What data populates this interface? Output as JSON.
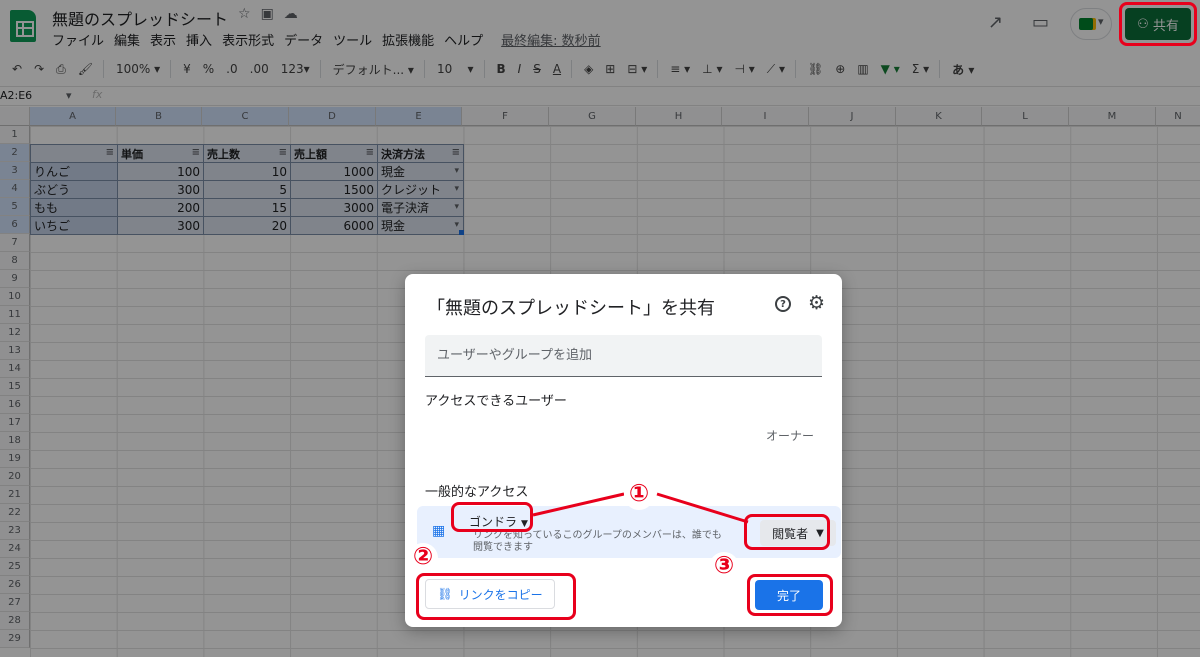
{
  "header": {
    "title": "無題のスプレッドシート",
    "menu": [
      "ファイル",
      "編集",
      "表示",
      "挿入",
      "表示形式",
      "データ",
      "ツール",
      "拡張機能",
      "ヘルプ"
    ],
    "last_edit": "最終編集: 数秒前",
    "share_label": "共有"
  },
  "toolbar": {
    "zoom": "100%",
    "currency": "¥",
    "percent": "%",
    "dec_less": ".0",
    "dec_more": ".00",
    "format": "123▾",
    "font": "デフォルト...",
    "font_size": "10",
    "input_tool": "あ"
  },
  "formula_bar": {
    "name_box": "A2:E6",
    "fx": "fx"
  },
  "grid": {
    "columns": [
      "A",
      "B",
      "C",
      "D",
      "E",
      "F",
      "G",
      "H",
      "I",
      "J",
      "K",
      "L",
      "M",
      "N"
    ],
    "rows": [
      "1",
      "2",
      "3",
      "4",
      "5",
      "6",
      "7",
      "8",
      "9",
      "10",
      "11",
      "12",
      "13",
      "14",
      "15",
      "16",
      "17",
      "18",
      "19",
      "20",
      "21",
      "22",
      "23",
      "24",
      "25",
      "26",
      "27",
      "28",
      "29"
    ],
    "table_headers": [
      "",
      "単価",
      "売上数",
      "売上額",
      "決済方法"
    ],
    "table_rows": [
      [
        "りんご",
        "100",
        "10",
        "1000",
        "現金"
      ],
      [
        "ぶどう",
        "300",
        "5",
        "1500",
        "クレジット"
      ],
      [
        "もも",
        "200",
        "15",
        "3000",
        "電子決済"
      ],
      [
        "いちご",
        "300",
        "20",
        "6000",
        "現金"
      ]
    ]
  },
  "dialog": {
    "title": "「無題のスプレッドシート」を共有",
    "add_placeholder": "ユーザーやグループを追加",
    "access_heading": "アクセスできるユーザー",
    "owner_label": "オーナー",
    "general_heading": "一般的なアクセス",
    "group_select": "ゴンドラ",
    "access_desc": "リンクを知っているこのグループのメンバーは、誰でも閲覧できます",
    "role_select": "閲覧者",
    "copy_link": "リンクをコピー",
    "done": "完了"
  },
  "annotations": {
    "marks": [
      "①",
      "②",
      "③"
    ],
    "color": "#e8001c"
  }
}
